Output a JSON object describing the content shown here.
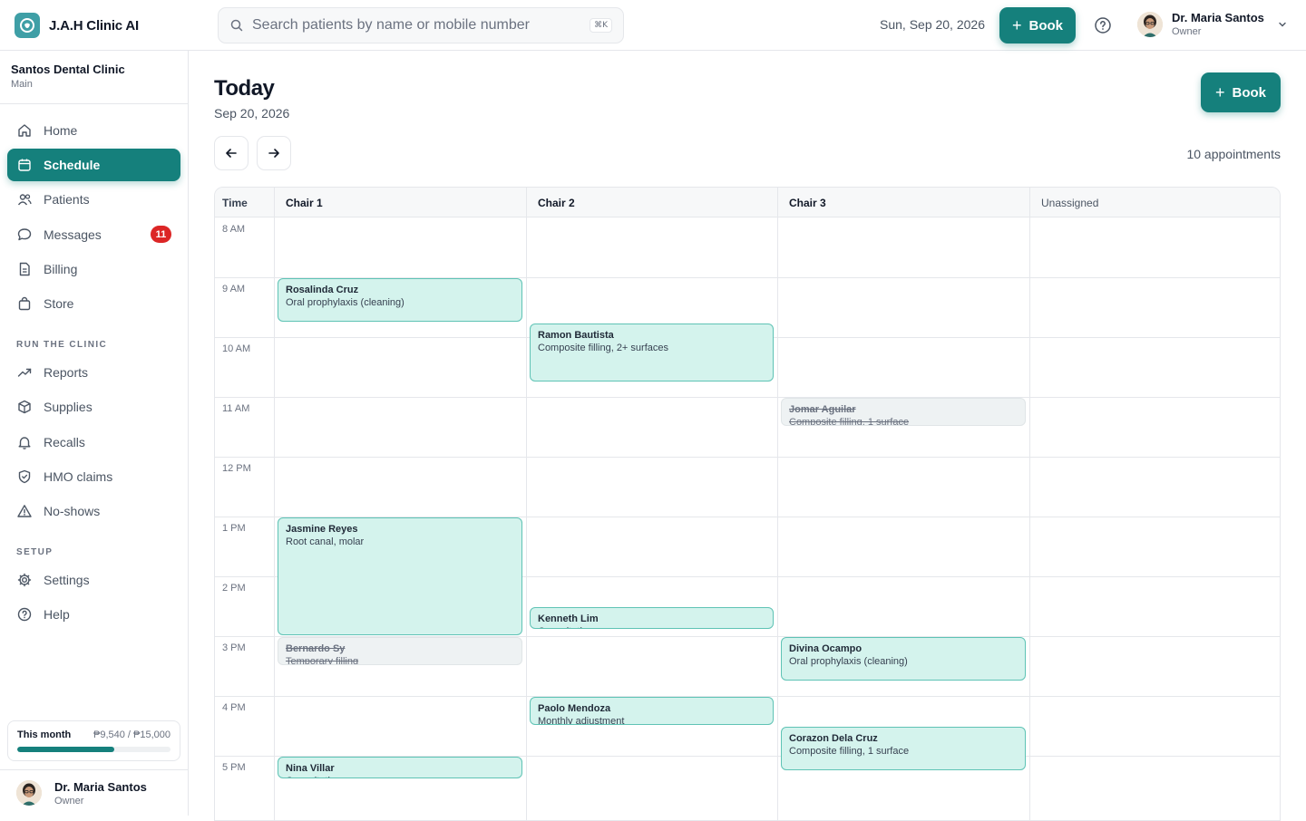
{
  "brand": {
    "name": "J.A.H Clinic AI"
  },
  "search": {
    "placeholder": "Search patients by name or mobile number",
    "shortcut": "⌘K"
  },
  "topbar": {
    "date": "Sun, Sep 20, 2026",
    "book_label": "Book",
    "user_name": "Dr. Maria Santos",
    "user_role": "Owner"
  },
  "sidebar": {
    "clinic_name": "Santos Dental Clinic",
    "clinic_branch": "Main",
    "items": [
      {
        "label": "Home",
        "icon": "home-icon"
      },
      {
        "label": "Schedule",
        "icon": "calendar-icon",
        "active": true
      },
      {
        "label": "Patients",
        "icon": "users-icon"
      },
      {
        "label": "Messages",
        "icon": "message-icon",
        "badge": "11"
      },
      {
        "label": "Billing",
        "icon": "receipt-icon"
      },
      {
        "label": "Store",
        "icon": "bag-icon"
      }
    ],
    "section_run": "RUN THE CLINIC",
    "run_items": [
      {
        "label": "Reports",
        "icon": "trend-icon"
      },
      {
        "label": "Supplies",
        "icon": "box-icon"
      },
      {
        "label": "Recalls",
        "icon": "bell-icon"
      },
      {
        "label": "HMO claims",
        "icon": "shield-icon"
      },
      {
        "label": "No-shows",
        "icon": "warning-icon"
      }
    ],
    "section_setup": "SETUP",
    "setup_items": [
      {
        "label": "Settings",
        "icon": "gear-icon"
      },
      {
        "label": "Help",
        "icon": "help-icon"
      }
    ],
    "quota": {
      "label": "This month",
      "value": "₱9,540 / ₱15,000",
      "fraction": 0.636
    },
    "user_name": "Dr. Maria Santos",
    "user_role": "Owner"
  },
  "main": {
    "title": "Today",
    "date": "Sep 20, 2026",
    "book_label": "Book",
    "appointment_count": "10 appointments"
  },
  "schedule": {
    "columns": [
      "Time",
      "Chair 1",
      "Chair 2",
      "Chair 3",
      "Unassigned"
    ],
    "hours": [
      "8 AM",
      "9 AM",
      "10 AM",
      "11 AM",
      "12 PM",
      "1 PM",
      "2 PM",
      "3 PM",
      "4 PM",
      "5 PM"
    ],
    "appointments": [
      {
        "patient": "Rosalinda Cruz",
        "service": "Oral prophylaxis (cleaning)",
        "chair": 1,
        "start": 9.0,
        "end": 9.75,
        "status": "booked"
      },
      {
        "patient": "Ramon Bautista",
        "service": "Composite filling, 2+ surfaces",
        "chair": 2,
        "start": 9.75,
        "end": 10.75,
        "status": "booked"
      },
      {
        "patient": "Jomar Aguilar",
        "service": "Composite filling, 1 surface",
        "chair": 3,
        "start": 11.0,
        "end": 11.5,
        "status": "cancelled"
      },
      {
        "patient": "Jasmine Reyes",
        "service": "Root canal, molar",
        "chair": 1,
        "start": 13.0,
        "end": 15.0,
        "status": "booked"
      },
      {
        "patient": "Kenneth Lim",
        "service": "Consultation",
        "chair": 2,
        "start": 14.5,
        "end": 14.9,
        "status": "booked"
      },
      {
        "patient": "Bernardo Sy",
        "service": "Temporary filling",
        "chair": 1,
        "start": 15.0,
        "end": 15.5,
        "status": "cancelled"
      },
      {
        "patient": "Divina Ocampo",
        "service": "Oral prophylaxis (cleaning)",
        "chair": 3,
        "start": 15.0,
        "end": 15.75,
        "status": "booked"
      },
      {
        "patient": "Paolo Mendoza",
        "service": "Monthly adjustment",
        "chair": 2,
        "start": 16.0,
        "end": 16.5,
        "status": "booked"
      },
      {
        "patient": "Corazon Dela Cruz",
        "service": "Composite filling, 1 surface",
        "chair": 3,
        "start": 16.5,
        "end": 17.25,
        "status": "booked"
      },
      {
        "patient": "Nina Villar",
        "service": "Consultation",
        "chair": 1,
        "start": 17.0,
        "end": 17.4,
        "status": "booked"
      }
    ]
  },
  "colors": {
    "accent": "#15807c",
    "appointment_bg": "#d4f3ed",
    "appointment_border": "#5fc3b5",
    "badge": "#dc2626"
  }
}
